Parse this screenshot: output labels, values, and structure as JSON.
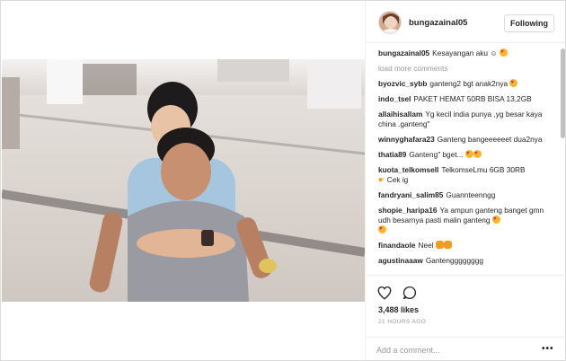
{
  "post": {
    "username": "bungazainal05",
    "follow_label": "Following",
    "caption_user": "bungazainal05",
    "caption_text": "Kesayangan aku",
    "load_more": "load more comments",
    "likes": "3,488 likes",
    "time": "21 HOURS AGO",
    "add_comment_placeholder": "Add a comment...",
    "more_icon": "more-options-icon",
    "like_icon": "heart-icon",
    "comment_icon": "comment-icon"
  },
  "comments": [
    {
      "user": "byozvic_sybb",
      "text": "ganteng2 bgt anak2nya",
      "emoji": "heart-eyes"
    },
    {
      "user": "indo_tsel",
      "text": "PAKET HEMAT 50RB BISA 13,2GB",
      "emoji": ""
    },
    {
      "user": "allaihisallam",
      "text": "Yg kecil india punya ,yg besar kaya china .ganteng\"",
      "emoji": ""
    },
    {
      "user": "winnyghafara23",
      "text": "Ganteng bangeeeeeet dua2nya",
      "emoji": ""
    },
    {
      "user": "thatia89",
      "text": "Ganteng\" bget...",
      "emoji": "heart-eyes-2"
    },
    {
      "user": "kuota_telkomsell",
      "text": "TelkomseLmu 6GB 30RB",
      "emoji": "",
      "extra": "Cek ig"
    },
    {
      "user": "fandryani_salim85",
      "text": "Guannteenngg",
      "emoji": ""
    },
    {
      "user": "shopie_haripa16",
      "text": "Ya ampun ganteng banget gmn udh besarnya pasti malin ganteng",
      "emoji": "heart-eyes"
    },
    {
      "user": "finandaole",
      "text": "Neel",
      "emoji": "cat-2"
    },
    {
      "user": "agustinaaaw",
      "text": "Gantengggggggg",
      "emoji": ""
    }
  ],
  "colors": {
    "text": "#262626",
    "muted": "#999999",
    "border": "#dbdbdb",
    "emoji": "#f7b52a"
  }
}
